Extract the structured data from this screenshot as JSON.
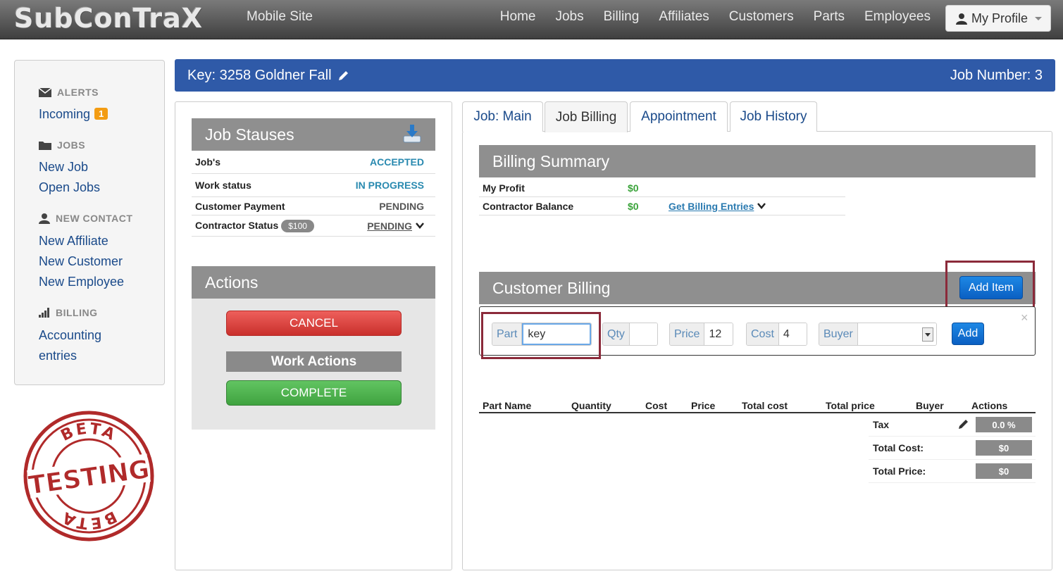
{
  "nav": {
    "brand": "SubConTraX",
    "mobile_site": "Mobile Site",
    "items": [
      "Home",
      "Jobs",
      "Billing",
      "Affiliates",
      "Customers",
      "Parts",
      "Employees"
    ],
    "profile": "My Profile"
  },
  "sidebar": {
    "alerts_head": "ALERTS",
    "incoming": "Incoming",
    "incoming_count": "1",
    "jobs_head": "JOBS",
    "new_job": "New Job",
    "open_jobs": "Open Jobs",
    "contact_head": "NEW CONTACT",
    "new_affiliate": "New Affiliate",
    "new_customer": "New Customer",
    "new_employee": "New Employee",
    "billing_head": "BILLING",
    "accounting": "Accounting",
    "entries": "entries",
    "stamp_top": "BETA",
    "stamp_main": "TESTING",
    "stamp_bottom": "BETA"
  },
  "keybar": {
    "key": "Key: 3258 Goldner Fall",
    "job_number": "Job Number: 3"
  },
  "statuses": {
    "title": "Job Stauses",
    "rows": [
      {
        "label": "Job's",
        "value": "ACCEPTED"
      },
      {
        "label": "Work status",
        "value": "IN PROGRESS"
      },
      {
        "label": "Customer Payment",
        "value": "PENDING"
      },
      {
        "label": "Contractor Status",
        "pill": "$100",
        "value": "PENDING"
      }
    ]
  },
  "actions": {
    "title": "Actions",
    "cancel": "CANCEL",
    "work_actions": "Work Actions",
    "complete": "COMPLETE"
  },
  "tabs": [
    "Job: Main",
    "Job Billing",
    "Appointment",
    "Job History"
  ],
  "billing_summary": {
    "title": "Billing Summary",
    "profit_label": "My Profit",
    "profit_value": "$0",
    "balance_label": "Contractor Balance",
    "balance_value": "$0",
    "entries_link": "Get Billing Entries"
  },
  "customer_billing": {
    "title": "Customer Billing",
    "add_item": "Add Item",
    "form": {
      "part_label": "Part",
      "part_value": "key",
      "qty_label": "Qty",
      "qty_value": "",
      "price_label": "Price",
      "price_value": "12",
      "cost_label": "Cost",
      "cost_value": "4",
      "buyer_label": "Buyer",
      "buyer_value": "",
      "add": "Add"
    },
    "columns": [
      "Part Name",
      "Quantity",
      "Cost",
      "Price",
      "Total cost",
      "Total price",
      "Buyer",
      "Actions"
    ],
    "tax_label": "Tax",
    "tax_value": "0.0 %",
    "total_cost_label": "Total Cost:",
    "total_cost_value": "$0",
    "total_price_label": "Total Price:",
    "total_price_value": "$0"
  }
}
